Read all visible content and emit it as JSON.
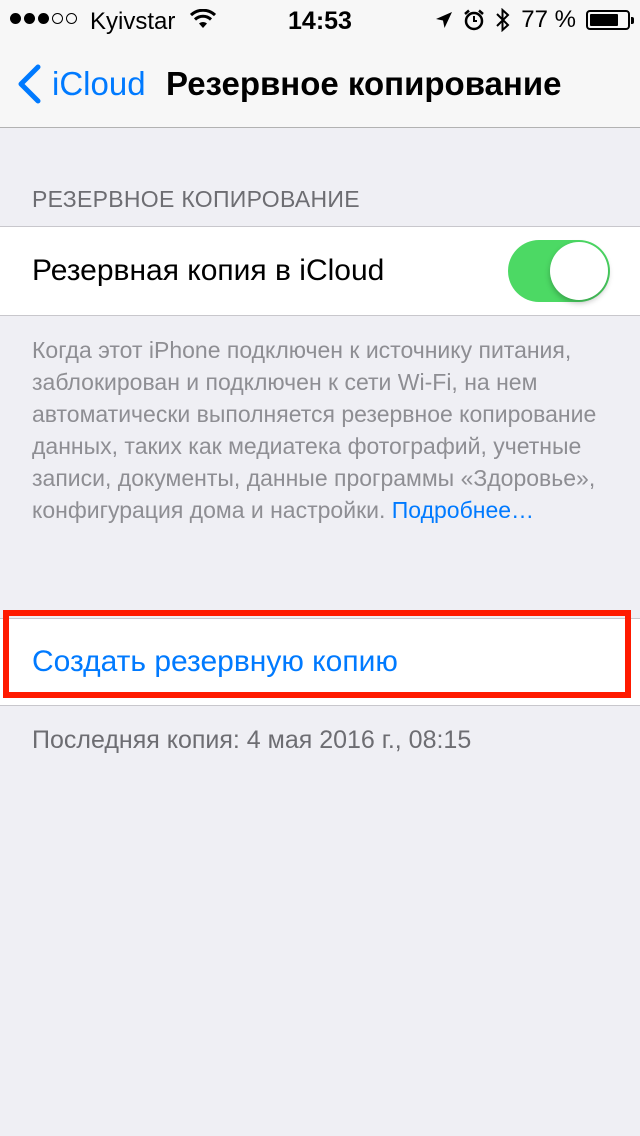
{
  "status_bar": {
    "signal_bars_filled": 3,
    "signal_bars_total": 5,
    "carrier": "Kyivstar",
    "time": "14:53",
    "battery_percent": "77 %",
    "battery_level": 0.77,
    "icons": [
      "wifi-icon",
      "location-icon",
      "alarm-icon",
      "bluetooth-icon",
      "battery-icon"
    ]
  },
  "nav": {
    "back_label": "iCloud",
    "title": "Резервное копирование"
  },
  "backup_section": {
    "header": "РЕЗЕРВНОЕ КОПИРОВАНИЕ",
    "toggle_label": "Резервная копия в iCloud",
    "toggle_on": true,
    "footer": "Когда этот iPhone подключен к источнику питания, заблокирован и подключен к сети Wi-Fi, на нем автоматически выполняется резервное копирование данных, таких как медиатека фотографий, учетные записи, документы, данные программы «Здоровье», конфигурация дома и настройки.",
    "learn_more": "Подробнее…"
  },
  "action": {
    "label": "Создать резервную копию",
    "highlight_color": "#ff1a00"
  },
  "last_backup": "Последняя копия: 4 мая 2016 г., 08:15",
  "colors": {
    "accent": "#007aff",
    "toggle_on": "#4cd964",
    "background": "#efeff4"
  }
}
